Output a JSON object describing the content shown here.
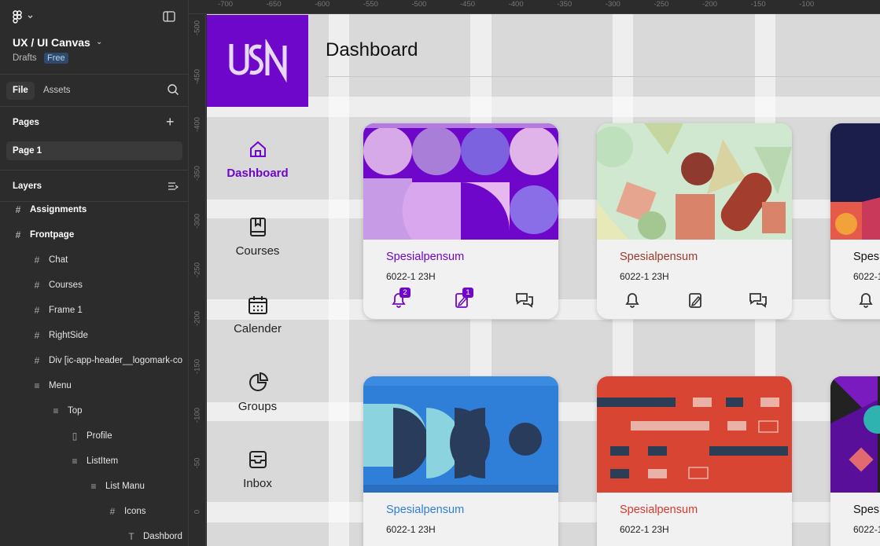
{
  "sidebar": {
    "canvas_name": "UX / UI Canvas",
    "drafts": "Drafts",
    "plan_badge": "Free",
    "tabs": [
      {
        "label": "File"
      },
      {
        "label": "Assets"
      }
    ],
    "pages_heading": "Pages",
    "pages": [
      {
        "label": "Page 1"
      }
    ],
    "layers_heading": "Layers",
    "layers": [
      {
        "label": "Assignments",
        "icon": "frame-icon",
        "bold": true
      },
      {
        "label": "Frontpage",
        "icon": "frame-icon",
        "bold": true
      },
      {
        "label": "Chat",
        "icon": "frame-icon"
      },
      {
        "label": "Courses",
        "icon": "frame-icon"
      },
      {
        "label": "Frame 1",
        "icon": "frame-icon"
      },
      {
        "label": "RightSide",
        "icon": "frame-icon"
      },
      {
        "label": "Div [ic-app-header__logomark-co",
        "icon": "frame-icon"
      },
      {
        "label": "Menu",
        "icon": "auto-layout-icon"
      },
      {
        "label": "Top",
        "icon": "auto-layout-icon"
      },
      {
        "label": "Profile",
        "icon": "component-bar-icon"
      },
      {
        "label": "ListItem",
        "icon": "auto-layout-icon"
      },
      {
        "label": "List Manu",
        "icon": "auto-layout-icon"
      },
      {
        "label": "Icons",
        "icon": "frame-icon"
      },
      {
        "label": "Dashbord",
        "icon": "text-icon"
      }
    ]
  },
  "ruler": {
    "top": [
      "-700",
      "-650",
      "-600",
      "-550",
      "-500",
      "-450",
      "-400",
      "-350",
      "-300",
      "-250",
      "-200",
      "-150",
      "-100"
    ],
    "left": [
      "-500",
      "-450",
      "-400",
      "-350",
      "-300",
      "-250",
      "-200",
      "-150",
      "-100",
      "-50",
      "0"
    ]
  },
  "app": {
    "logo_text": "USN",
    "page_title": "Dashboard",
    "nav": [
      {
        "label": "Dashboard",
        "icon": "home-icon",
        "active": true
      },
      {
        "label": "Courses",
        "icon": "book-icon"
      },
      {
        "label": "Calender",
        "icon": "calendar-icon"
      },
      {
        "label": "Groups",
        "icon": "pie-chart-icon"
      },
      {
        "label": "Inbox",
        "icon": "inbox-icon"
      }
    ],
    "cards": [
      {
        "name": "Spesialpensum",
        "code": "6022-1 23H",
        "color": "#6f07cb",
        "notifications": "2",
        "assignments": "1",
        "art": "purple"
      },
      {
        "name": "Spesialpensum",
        "code": "6022-1 23H",
        "color": "#9a3b2b",
        "notifications": "",
        "assignments": "",
        "art": "green"
      },
      {
        "name": "Spes",
        "code": "6022-1",
        "color": "#111111",
        "notifications": "",
        "assignments": "",
        "art": "navy"
      },
      {
        "name": "Spesialpensum",
        "code": "6022-1 23H",
        "color": "#2f7ed8",
        "notifications": "",
        "assignments": "",
        "art": "blue"
      },
      {
        "name": "Spesialpensum",
        "code": "6022-1 23H",
        "color": "#d9382c",
        "notifications": "",
        "assignments": "",
        "art": "red"
      },
      {
        "name": "Spes",
        "code": "6022-1",
        "color": "#111111",
        "notifications": "",
        "assignments": "",
        "art": "dark"
      }
    ]
  },
  "colors": {
    "brand": "#6f07cb",
    "panel": "#2c2c2c",
    "canvas": "#d9d9d9"
  }
}
